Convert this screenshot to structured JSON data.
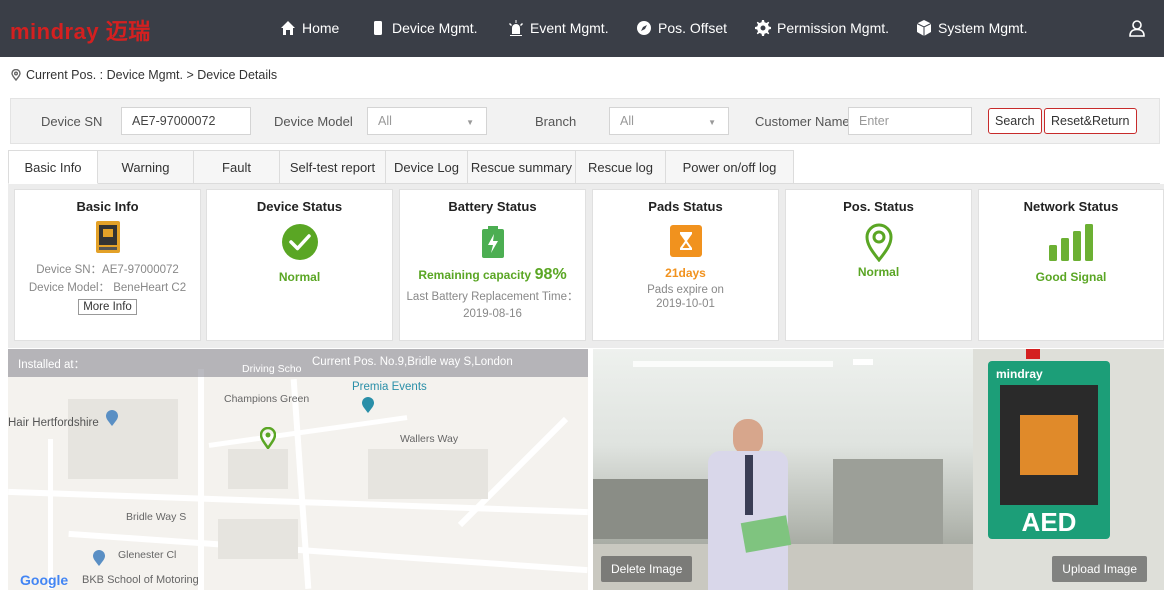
{
  "brand": {
    "logo": "mindray 迈瑞"
  },
  "nav": {
    "items": [
      {
        "label": "Home",
        "icon": "home-icon"
      },
      {
        "label": "Device Mgmt.",
        "icon": "device-icon"
      },
      {
        "label": "Event Mgmt.",
        "icon": "alarm-icon"
      },
      {
        "label": "Pos. Offset",
        "icon": "compass-icon"
      },
      {
        "label": "Permission Mgmt.",
        "icon": "gear-icon"
      },
      {
        "label": "System Mgmt.",
        "icon": "cube-icon"
      }
    ],
    "user_icon": "user-icon"
  },
  "breadcrumb": {
    "text": "Current Pos. : Device Mgmt. > Device Details"
  },
  "filters": {
    "device_sn_label": "Device SN",
    "device_sn_value": "AE7-97000072",
    "device_model_label": "Device Model",
    "device_model_value": "All",
    "branch_label": "Branch",
    "branch_value": "All",
    "customer_label": "Customer Name",
    "customer_placeholder": "Enter",
    "search_label": "Search",
    "reset_label": "Reset&Return"
  },
  "tabs": [
    {
      "label": "Basic Info"
    },
    {
      "label": "Warning"
    },
    {
      "label": "Fault"
    },
    {
      "label": "Self-test report"
    },
    {
      "label": "Device Log"
    },
    {
      "label": "Rescue summary"
    },
    {
      "label": "Rescue log"
    },
    {
      "label": "Power on/off log"
    }
  ],
  "cards": {
    "basic": {
      "title": "Basic Info",
      "sn_line": "Device SN：AE7-97000072",
      "model_line": "Device Model： BeneHeart C2",
      "more": "More Info"
    },
    "device": {
      "title": "Device Status",
      "status": "Normal"
    },
    "battery": {
      "title": "Battery Status",
      "remaining_label": "Remaining capacity",
      "remaining_value": "98%",
      "replace_label": "Last Battery Replacement Time：",
      "replace_date": "2019-08-16"
    },
    "pads": {
      "title": "Pads Status",
      "days": "21days",
      "expire_label": "Pads expire on",
      "expire_date": "2019-10-01"
    },
    "pos": {
      "title": "Pos. Status",
      "status": "Normal"
    },
    "network": {
      "title": "Network Status",
      "status": "Good Signal"
    }
  },
  "map": {
    "installed_label": "Installed at：",
    "address": "Current Pos. No.9,Bridle way S,London",
    "labels": {
      "driving": "Driving Scho",
      "premia": "Premia Events",
      "champions_green": "Champions Green",
      "hair": "Hair Hertfordshire",
      "wallers": "Wallers Way",
      "bridle": "Bridle Way S",
      "glenester": "Glenester Cl",
      "bkb": "BKB School of Motoring",
      "google": "Google"
    }
  },
  "photo": {
    "delete_label": "Delete Image",
    "upload_label": "Upload Image",
    "aed_brand": "mindray",
    "aed_label": "AED"
  },
  "colors": {
    "nav_bg": "#3a3e47",
    "brand_red": "#d42020",
    "ok_green": "#5aa624",
    "warn_orange": "#f1921e",
    "network_green": "#6cb033"
  }
}
